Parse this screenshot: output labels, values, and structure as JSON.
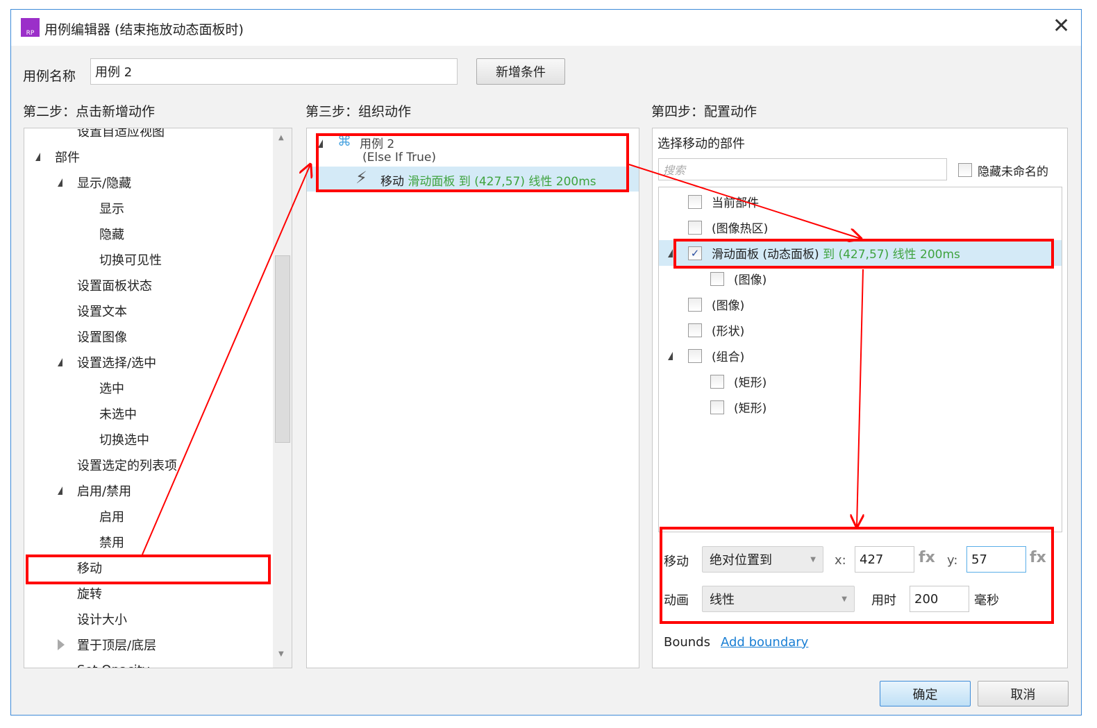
{
  "title": "用例编辑器 (结束拖放动态面板时)",
  "case_name": {
    "label": "用例名称",
    "value": "用例 2"
  },
  "add_condition": "新增条件",
  "step2": {
    "heading": "第二步：点击新增动作",
    "items": [
      {
        "label": "设置自适应视图",
        "level": 1
      },
      {
        "label": "部件",
        "level": 0,
        "toggle": "expanded"
      },
      {
        "label": "显示/隐藏",
        "level": 1,
        "toggle": "expanded"
      },
      {
        "label": "显示",
        "level": 2
      },
      {
        "label": "隐藏",
        "level": 2
      },
      {
        "label": "切换可见性",
        "level": 2
      },
      {
        "label": "设置面板状态",
        "level": 1
      },
      {
        "label": "设置文本",
        "level": 1
      },
      {
        "label": "设置图像",
        "level": 1
      },
      {
        "label": "设置选择/选中",
        "level": 1,
        "toggle": "expanded"
      },
      {
        "label": "选中",
        "level": 2
      },
      {
        "label": "未选中",
        "level": 2
      },
      {
        "label": "切换选中",
        "level": 2
      },
      {
        "label": "设置选定的列表项",
        "level": 1
      },
      {
        "label": "启用/禁用",
        "level": 1,
        "toggle": "expanded"
      },
      {
        "label": "启用",
        "level": 2
      },
      {
        "label": "禁用",
        "level": 2
      },
      {
        "label": "移动",
        "level": 1,
        "highlighted": true
      },
      {
        "label": "旋转",
        "level": 1
      },
      {
        "label": "设计大小",
        "level": 1
      },
      {
        "label": "置于顶层/底层",
        "level": 1,
        "toggle": "collapsed"
      },
      {
        "label": "Set Opacity",
        "level": 1
      }
    ]
  },
  "step3": {
    "heading": "第三步：组织动作",
    "case_label": "用例 2",
    "condition": "(Else If True)",
    "action_verb": "移动",
    "action_detail": "滑动面板 到 (427,57) 线性 200ms"
  },
  "step4": {
    "heading": "第四步：配置动作",
    "subheading": "选择移动的部件",
    "search_placeholder": "搜索",
    "hide_unnamed": "隐藏未命名的",
    "widgets": [
      {
        "label": "当前部件",
        "level": 0,
        "checked": false
      },
      {
        "label": "(图像热区)",
        "level": 0,
        "checked": false
      },
      {
        "label": "滑动面板 (动态面板)",
        "suffix": "到 (427,57) 线性 200ms",
        "level": 0,
        "checked": true,
        "toggle": "expanded",
        "selected": true
      },
      {
        "label": "(图像)",
        "level": 1,
        "checked": false
      },
      {
        "label": "(图像)",
        "level": 0,
        "checked": false
      },
      {
        "label": "(形状)",
        "level": 0,
        "checked": false
      },
      {
        "label": "(组合)",
        "level": 0,
        "checked": false,
        "toggle": "expanded"
      },
      {
        "label": "(矩形)",
        "level": 1,
        "checked": false
      },
      {
        "label": "(矩形)",
        "level": 1,
        "checked": false
      }
    ],
    "move_label": "移动",
    "move_type": "绝对位置到",
    "x_label": "x:",
    "x_value": "427",
    "y_label": "y:",
    "y_value": "57",
    "fx": "fx",
    "anim_label": "动画",
    "anim_type": "线性",
    "duration_label": "用时",
    "duration_value": "200",
    "ms_label": "毫秒",
    "bounds_label": "Bounds",
    "add_boundary": "Add boundary"
  },
  "ok": "确定",
  "cancel": "取消",
  "colors": {
    "annotation": "#ff0000",
    "selected_row": "#d4eaf7",
    "action_text": "#3fa33f",
    "link": "#1a7fd4"
  }
}
